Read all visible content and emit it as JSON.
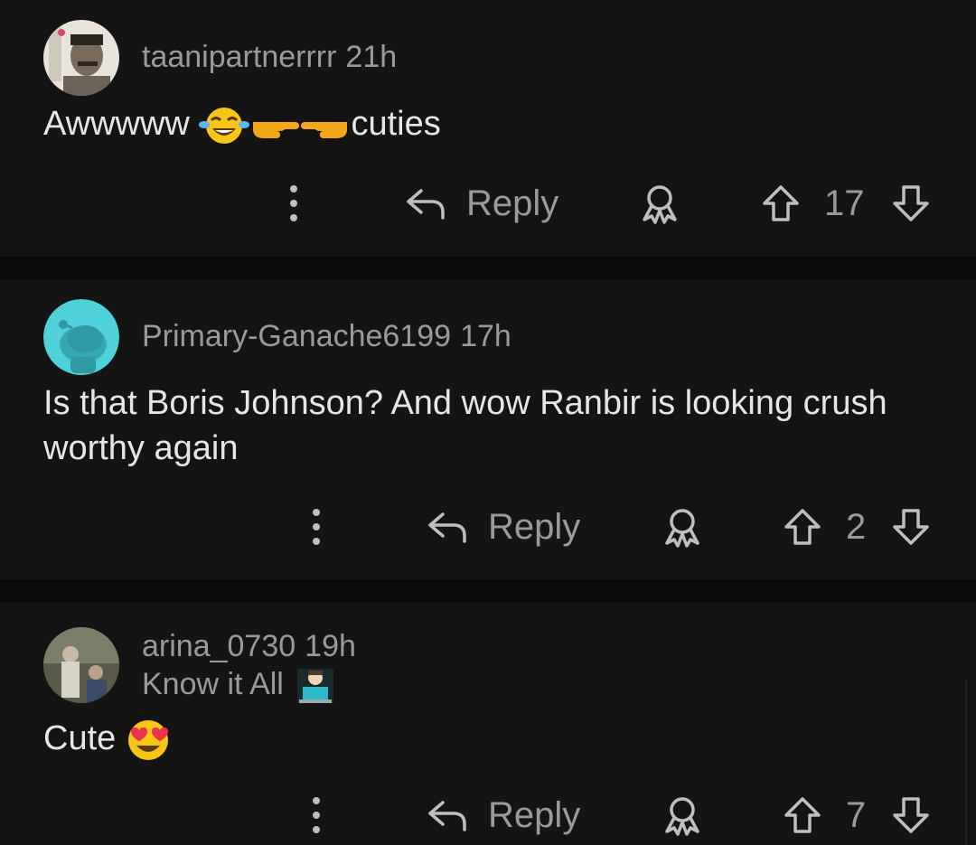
{
  "comments": [
    {
      "username": "taanipartnerrrr",
      "time": "21h",
      "body": "Awwwww",
      "body_suffix": "cuties",
      "emojis": [
        "face-with-tears-of-joy",
        "backhand-index-pointing-right",
        "backhand-index-pointing-left"
      ],
      "reply_label": "Reply",
      "votes": "17",
      "avatar": "photo-avatar"
    },
    {
      "username": "Primary-Ganache6199",
      "time": "17h",
      "body": "Is that Boris Johnson?  And wow Ranbir is looking crush worthy again",
      "reply_label": "Reply",
      "votes": "2",
      "avatar": "snoo-avatar",
      "avatar_color": "#4fd1d9"
    },
    {
      "username": "arina_0730",
      "time": "19h",
      "flair": "Know it All",
      "flair_emoji": "technologist",
      "body": "Cute",
      "emojis": [
        "smiling-face-with-heart-eyes"
      ],
      "reply_label": "Reply",
      "votes": "7",
      "avatar": "photo-avatar"
    }
  ],
  "colors": {
    "background": "#0b0b0b",
    "card": "#141414",
    "muted_text": "#9a9a9a",
    "body_text": "#e6e6e6"
  }
}
